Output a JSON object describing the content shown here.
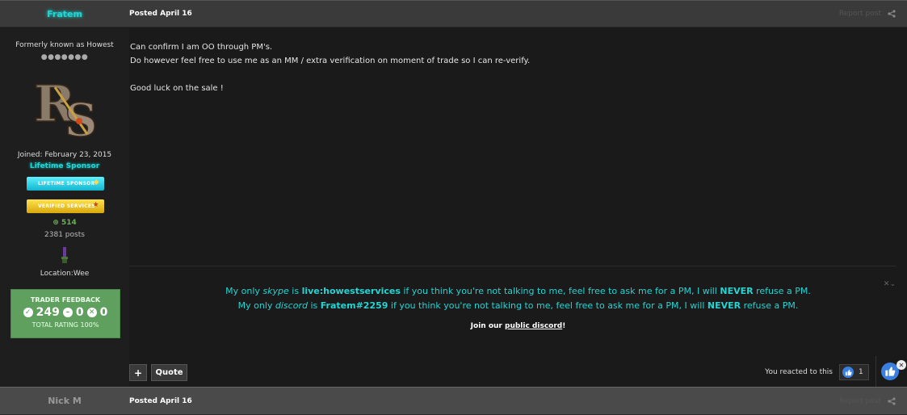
{
  "post1": {
    "author": "Fratem",
    "posted": "Posted April 16",
    "report": "Report post",
    "author_title": "Formerly known as Howest",
    "rank_dots": "●●●●●●●",
    "joined": "Joined: February 23, 2015",
    "sponsor_label": "Lifetime Sponsor",
    "badge_lifetime": "LIFETIME SPONSOR",
    "badge_verified": "VERIFIED SERVICES",
    "reputation": "514",
    "posts": "2381 posts",
    "location": "Location:Wee",
    "trader": {
      "title": "TRADER FEEDBACK",
      "positive": "249",
      "neutral": "0",
      "negative": "0",
      "total": "TOTAL RATING 100%"
    },
    "message": [
      "Can confirm I am OO through PM's.",
      "Do however feel free to use me as an MM / extra verification on moment of trade so I can re-verify.",
      "Good luck on the sale !"
    ],
    "signature": {
      "line1": {
        "pre": "My only ",
        "platform": "skype",
        "is": " is ",
        "handle": "live:howestservices",
        "mid": " if you think you're not talking to me, feel free to ask me for a PM, I will ",
        "never": "NEVER",
        "post": " refuse a PM."
      },
      "line2": {
        "pre": "My only ",
        "platform": "discord",
        "is": " is ",
        "handle": "Fratem#2259",
        "mid": " if you think you're not talking to me, feel free to ask me for a PM, I will ",
        "never": "NEVER",
        "post": " refuse a PM."
      },
      "join_pre": "Join our ",
      "join_link": "public discord",
      "join_post": "!"
    },
    "buttons": {
      "plus": "+",
      "quote": "Quote"
    },
    "reacted": "You reacted to this",
    "reaction_count": "1"
  },
  "post2": {
    "author": "Nick M",
    "posted": "Posted April 16",
    "report": "Report post"
  }
}
